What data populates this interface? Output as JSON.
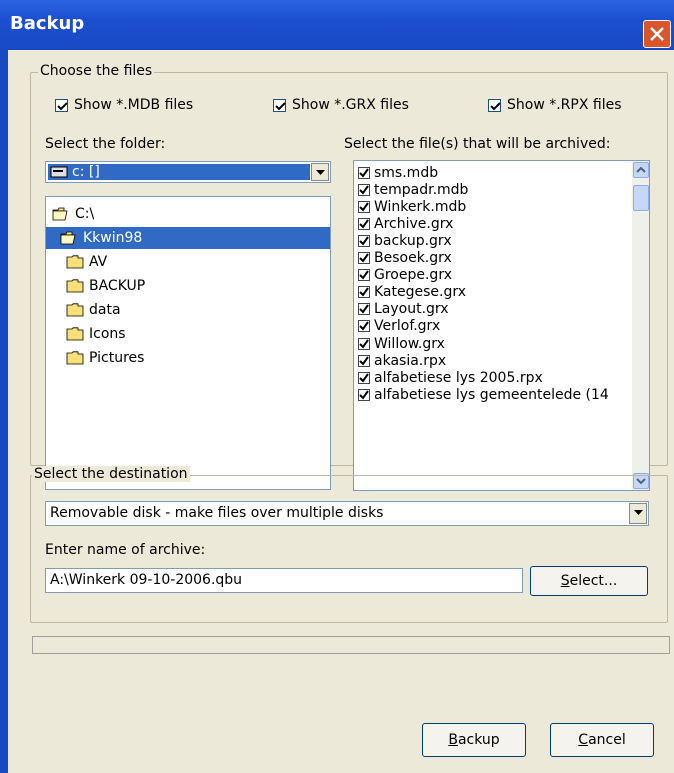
{
  "window": {
    "title": "Backup"
  },
  "choose_group": {
    "label": "Choose the files",
    "checks": [
      {
        "label": "Show *.MDB files",
        "checked": true
      },
      {
        "label": "Show *.GRX files",
        "checked": true
      },
      {
        "label": "Show *.RPX files",
        "checked": true
      }
    ],
    "folder_label": "Select the folder:",
    "drive_value": "c: []",
    "folders": [
      "C:\\",
      "Kkwin98",
      "AV",
      "BACKUP",
      "data",
      "Icons",
      "Pictures"
    ],
    "files_label": "Select the file(s) that will be archived:",
    "files": [
      "sms.mdb",
      "tempadr.mdb",
      "Winkerk.mdb",
      "Archive.grx",
      "backup.grx",
      "Besoek.grx",
      "Groepe.grx",
      "Kategese.grx",
      "Layout.grx",
      "Verlof.grx",
      "Willow.grx",
      "akasia.rpx",
      "alfabetiese lys 2005.rpx",
      "alfabetiese lys gemeentelede (14"
    ]
  },
  "destination_group": {
    "label": "Select the destination",
    "destination_value": "Removable disk - make files over multiple disks",
    "archive_label": "Enter name of archive:",
    "archive_value": "A:\\Winkerk 09-10-2006.qbu",
    "select_underline": "S",
    "select_rest": "elect..."
  },
  "buttons": {
    "backup_underline": "B",
    "backup_rest": "ackup",
    "cancel_underline": "C",
    "cancel_rest": "ancel"
  },
  "colors": {
    "title_bar": "#1c4fd0",
    "selection": "#316ac5",
    "dialog_bg": "#ece9d8"
  }
}
